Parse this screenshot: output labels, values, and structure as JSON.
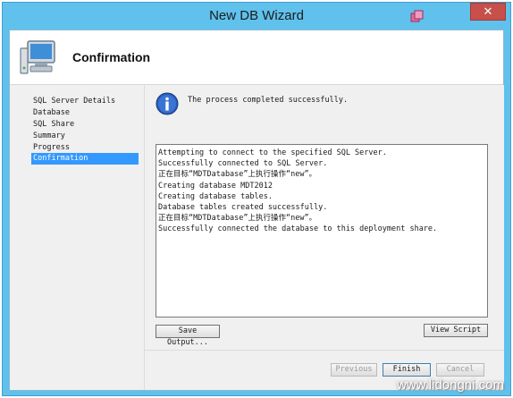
{
  "window": {
    "title": "New DB Wizard",
    "close_glyph": "✕",
    "accent_color": "#5fc1ec",
    "close_color": "#c7504a"
  },
  "header": {
    "title": "Confirmation",
    "icon": "computer-icon"
  },
  "nav": {
    "items": [
      {
        "label": "SQL Server Details",
        "active": false
      },
      {
        "label": "Database",
        "active": false
      },
      {
        "label": "SQL Share",
        "active": false
      },
      {
        "label": "Summary",
        "active": false
      },
      {
        "label": "Progress",
        "active": false
      },
      {
        "label": "Confirmation",
        "active": true
      }
    ],
    "selected_color": "#3399ff"
  },
  "main": {
    "info_icon": "info-icon",
    "status_message": "The process completed successfully.",
    "log_lines": [
      "Attempting to connect to the specified SQL Server.",
      "Successfully connected to SQL Server.",
      "正在目标“MDTDatabase”上执行操作“new”。",
      "Creating database MDT2012",
      "Creating database tables.",
      "Database tables created successfully.",
      "正在目标“MDTDatabase”上执行操作“new”。",
      "Successfully connected the database to this deployment share."
    ],
    "save_output_label": "Save Output...",
    "view_script_label": "View Script"
  },
  "footer": {
    "previous_label": "Previous",
    "finish_label": "Finish",
    "cancel_label": "Cancel"
  },
  "watermark": "www.lidongni.com"
}
